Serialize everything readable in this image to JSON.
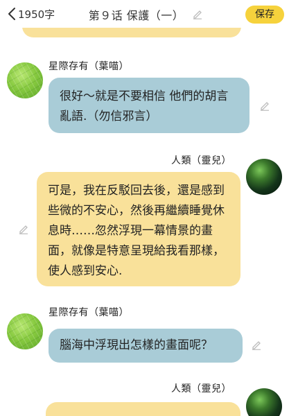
{
  "header": {
    "back_label": "",
    "word_count": "1950字",
    "title": "第９话 保護（一）",
    "save_label": "保存"
  },
  "messages": [
    {
      "sender": "星際存有（葉喵）",
      "side": "left",
      "text": "很好～就是不要相信  他們的胡言亂語.（勿信邪言）"
    },
    {
      "sender": "人類（靈兒）",
      "side": "right",
      "text": "可是，我在反駁回去後，還是感到些微的不安心，然後再繼續睡覺休息時……忽然浮現一幕情景的畫面，就像是特意呈現給我看那樣，使人感到安心."
    },
    {
      "sender": "星際存有（葉喵）",
      "side": "left",
      "text": "腦海中浮現出怎樣的畫面呢？"
    },
    {
      "sender": "人類（靈兒）",
      "side": "right",
      "text": ""
    }
  ],
  "icons": {
    "back": "chevron-left-icon",
    "edit": "pencil-icon",
    "avatar_left": "leaf-avatar",
    "avatar_right": "green-sphere-avatar"
  },
  "colors": {
    "accent": "#f6d23c",
    "bubble_left": "#a9ccd7",
    "bubble_right": "#f9e19a"
  }
}
